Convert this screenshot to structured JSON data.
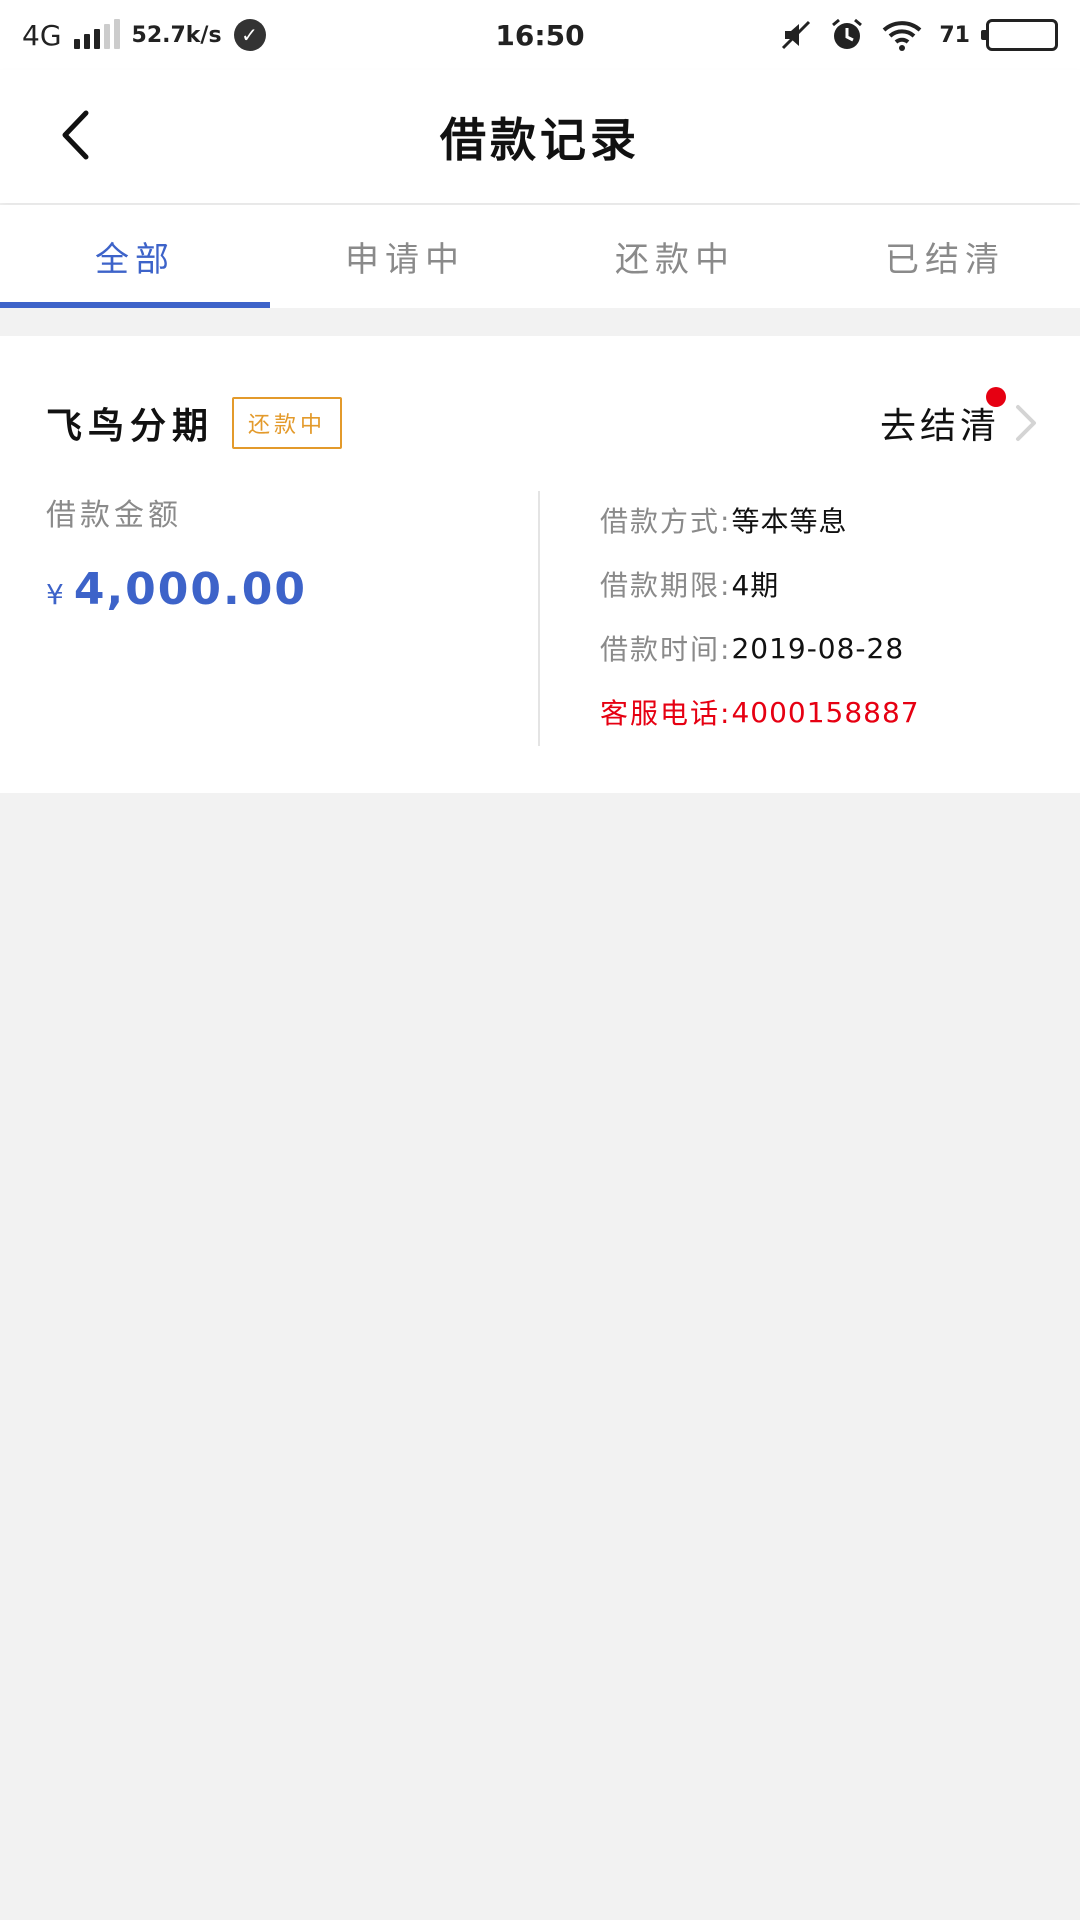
{
  "status_bar": {
    "network": "4G",
    "speed": "52.7k/s",
    "time": "16:50",
    "battery": "71"
  },
  "nav": {
    "title": "借款记录"
  },
  "tabs": [
    {
      "label": "全部",
      "active": true
    },
    {
      "label": "申请中",
      "active": false
    },
    {
      "label": "还款中",
      "active": false
    },
    {
      "label": "已结清",
      "active": false
    }
  ],
  "loan_card": {
    "product_name": "飞鸟分期",
    "status_tag": "还款中",
    "action_label": "去结清",
    "amount_label": "借款金额",
    "currency_symbol": "¥",
    "amount": "4,000.00",
    "details": [
      {
        "key": "借款方式:",
        "value": "等本等息"
      },
      {
        "key": "借款期限:",
        "value": "4期"
      },
      {
        "key": "借款时间:",
        "value": "2019-08-28"
      },
      {
        "key": "客服电话:",
        "value": "4000158887"
      }
    ]
  },
  "colors": {
    "accent": "#3d63c9",
    "status_tag": "#e39a2b",
    "alert": "#e60012"
  }
}
